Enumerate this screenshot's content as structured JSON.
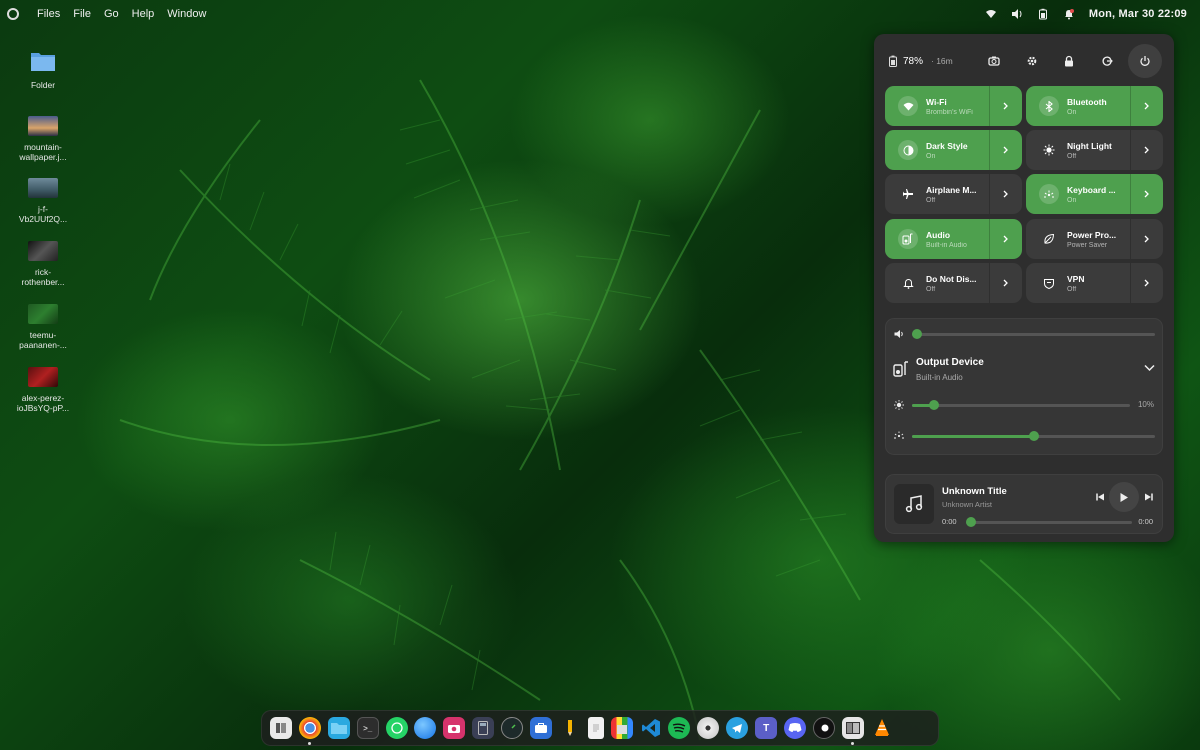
{
  "topbar": {
    "menus": [
      "Files",
      "File",
      "Go",
      "Help",
      "Window"
    ],
    "clock": "Mon, Mar 30  22:09",
    "tray_icons": [
      "wifi-icon",
      "volume-icon",
      "battery-icon",
      "notification-icon"
    ]
  },
  "desktop": {
    "icons": [
      {
        "label": "Folder",
        "kind": "folder"
      },
      {
        "label": "mountain-\nwallpaper.j...",
        "kind": "image"
      },
      {
        "label": "j-f-\nVb2UUf2Q...",
        "kind": "image"
      },
      {
        "label": "rick-\nrothenber...",
        "kind": "image"
      },
      {
        "label": "teemu-\npaananen-...",
        "kind": "image"
      },
      {
        "label": "alex-perez-\nioJBsYQ-pP...",
        "kind": "image"
      }
    ]
  },
  "quick_settings": {
    "battery_percent": "78%",
    "battery_time": "· 16m",
    "header_buttons": [
      "screenshot-icon",
      "settings-icon",
      "lock-icon",
      "logout-icon",
      "power-icon"
    ],
    "tiles": [
      {
        "name": "Wi-Fi",
        "sub": "Brombin's WiFi",
        "on": true,
        "icon": "wifi-icon"
      },
      {
        "name": "Bluetooth",
        "sub": "On",
        "on": true,
        "icon": "bluetooth-icon"
      },
      {
        "name": "Dark Style",
        "sub": "On",
        "on": true,
        "icon": "dark-style-icon"
      },
      {
        "name": "Night Light",
        "sub": "Off",
        "on": false,
        "icon": "sun-icon"
      },
      {
        "name": "Airplane M...",
        "sub": "Off",
        "on": false,
        "icon": "airplane-icon"
      },
      {
        "name": "Keyboard ...",
        "sub": "On",
        "on": true,
        "icon": "keyboard-icon"
      },
      {
        "name": "Audio",
        "sub": "Built-in Audio",
        "on": true,
        "icon": "speaker-icon"
      },
      {
        "name": "Power Pro...",
        "sub": "Power Saver",
        "on": false,
        "icon": "leaf-icon"
      },
      {
        "name": "Do Not Dis...",
        "sub": "Off",
        "on": false,
        "icon": "bell-icon"
      },
      {
        "name": "VPN",
        "sub": "Off",
        "on": false,
        "icon": "shield-icon"
      }
    ],
    "volume_level": 0.0,
    "output_device": {
      "title": "Output Device",
      "value": "Built-in Audio"
    },
    "brightness": {
      "label": "10%",
      "level": 0.1
    },
    "keyboard_backlight_level": 0.5,
    "media": {
      "title": "Unknown Title",
      "artist": "Unknown Artist",
      "elapsed": "0:00",
      "total": "0:00",
      "progress": 0.0
    }
  },
  "dock": {
    "apps": [
      "files-app",
      "chrome",
      "files",
      "terminal",
      "whatsapp",
      "browser",
      "camera",
      "calculator",
      "system-monitor",
      "software-store",
      "pencil",
      "text-editor",
      "archive",
      "vscode",
      "spotify",
      "disks",
      "telegram",
      "teams",
      "discord",
      "toggle",
      "workspace",
      "vlc"
    ]
  },
  "colors": {
    "accent": "#4ea04e",
    "panel": "#2e2e2e",
    "tile_off": "#3b3b3b"
  }
}
